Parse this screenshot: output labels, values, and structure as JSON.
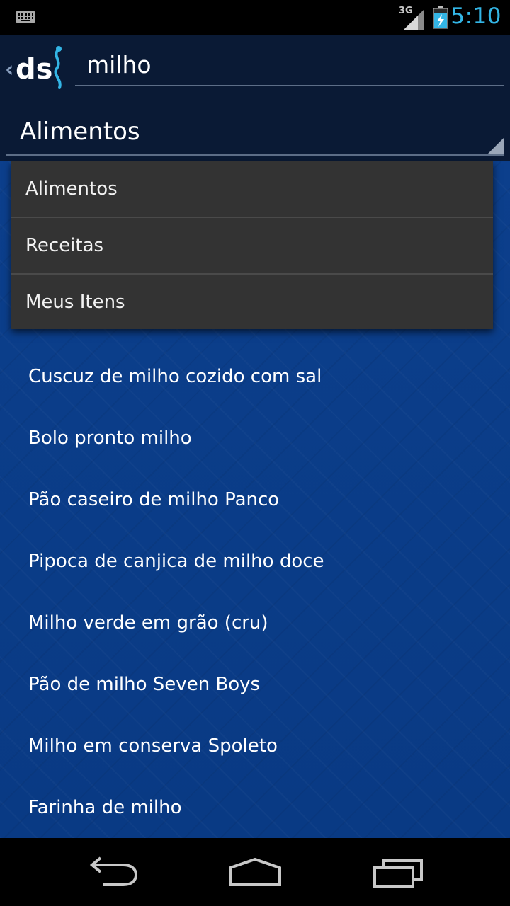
{
  "status_bar": {
    "network": "3G",
    "time": "5:10",
    "icons": [
      "keyboard-icon",
      "signal-icon",
      "battery-charging-icon"
    ]
  },
  "action_bar": {
    "logo": "ds",
    "search_value": "milho",
    "icons": [
      "up-chevron-icon",
      "app-logo-icon"
    ]
  },
  "spinner": {
    "selected": "Alimentos"
  },
  "dropdown": {
    "options": [
      {
        "label": "Alimentos"
      },
      {
        "label": "Receitas"
      },
      {
        "label": "Meus Itens"
      }
    ]
  },
  "results": [
    {
      "label": "Cuscuz de milho cozido com sal"
    },
    {
      "label": "Bolo pronto milho"
    },
    {
      "label": "Pão caseiro de milho Panco"
    },
    {
      "label": "Pipoca de canjica de milho doce"
    },
    {
      "label": "Milho verde em grão (cru)"
    },
    {
      "label": "Pão de milho Seven Boys"
    },
    {
      "label": "Milho em conserva Spoleto"
    },
    {
      "label": "Farinha de milho"
    }
  ],
  "nav_bar": {
    "icons": [
      "back-icon",
      "home-icon",
      "recents-icon"
    ]
  },
  "colors": {
    "accent": "#33b5e5",
    "action_bar": "#0a1a35",
    "list_background": "#0c3f8c",
    "dropdown_background": "#333333"
  }
}
